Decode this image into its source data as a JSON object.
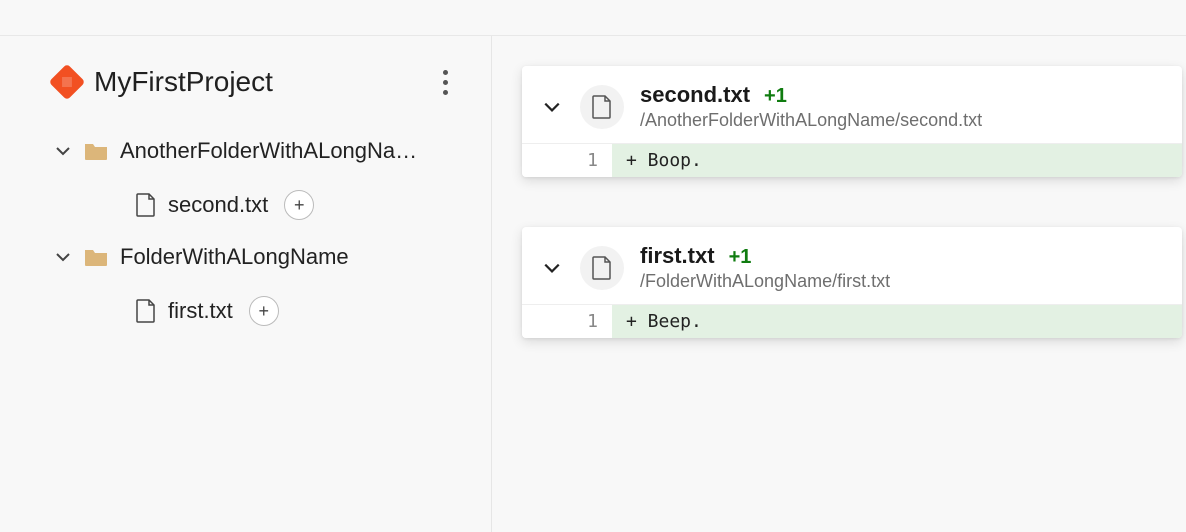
{
  "project": {
    "name": "MyFirstProject"
  },
  "tree": {
    "folders": [
      {
        "label": "AnotherFolderWithALongName",
        "files": [
          {
            "label": "second.txt"
          }
        ]
      },
      {
        "label": "FolderWithALongName",
        "files": [
          {
            "label": "first.txt"
          }
        ]
      }
    ]
  },
  "diffs": [
    {
      "filename": "second.txt",
      "stat": "+1",
      "path": "/AnotherFolderWithALongName/second.txt",
      "line_no": "1",
      "line_text": "+ Boop."
    },
    {
      "filename": "first.txt",
      "stat": "+1",
      "path": "/FolderWithALongName/first.txt",
      "line_no": "1",
      "line_text": "+ Beep."
    }
  ],
  "glyphs": {
    "add": "+"
  }
}
